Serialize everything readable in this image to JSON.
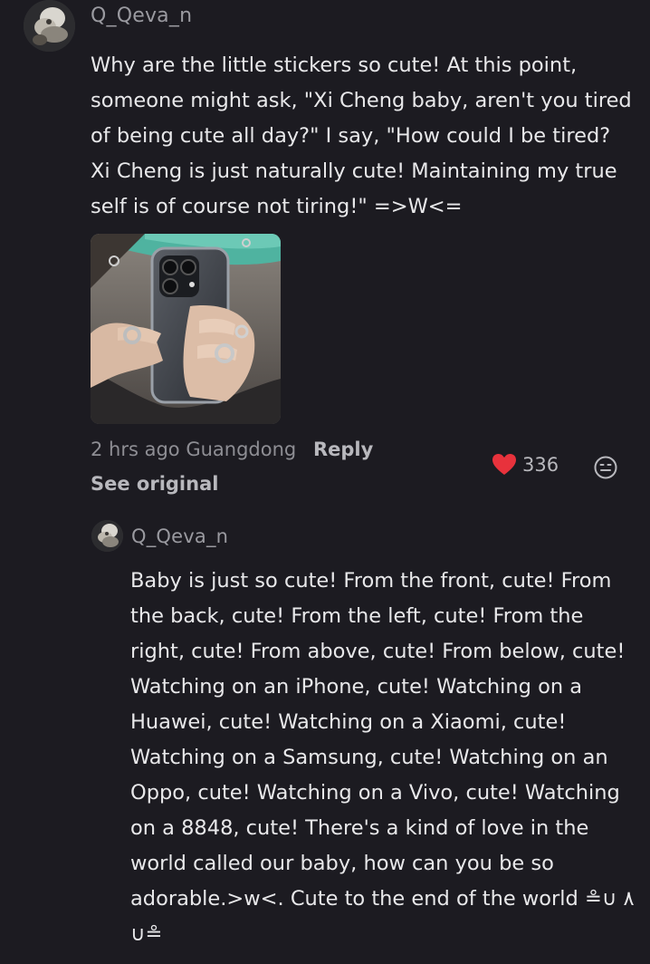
{
  "comment": {
    "username": "Q_Qeva_n",
    "text": "Why are the little stickers so cute! At this point, someone might ask, \"Xi Cheng baby, aren't you tired of being cute all day?\" I say, \"How could I be tired? Xi Cheng is just naturally cute! Maintaining my true self is of course not tiring!\" =>W<=",
    "time": "2 hrs ago",
    "location": "Guangdong",
    "reply_label": "Reply",
    "see_original_label": "See original",
    "like_count": "336",
    "like_color": "#e8323c"
  },
  "reply": {
    "username": "Q_Qeva_n",
    "text": "Baby is just so cute! From the front, cute! From the back, cute! From the left, cute! From the right, cute! From above, cute! From below, cute! Watching on an iPhone, cute! Watching on a Huawei, cute! Watching on a Xiaomi, cute! Watching on a Samsung, cute! Watching on an Oppo, cute! Watching on a Vivo, cute! Watching on a 8848, cute! There's a kind of love in the world called our baby, how can you be so adorable.>w<. Cute to the end of the world ≗∪ ٨ ∪≗"
  },
  "icons": {
    "avatar": "avatar-icon",
    "heart": "heart-icon",
    "emoji": "emoji-icon"
  }
}
